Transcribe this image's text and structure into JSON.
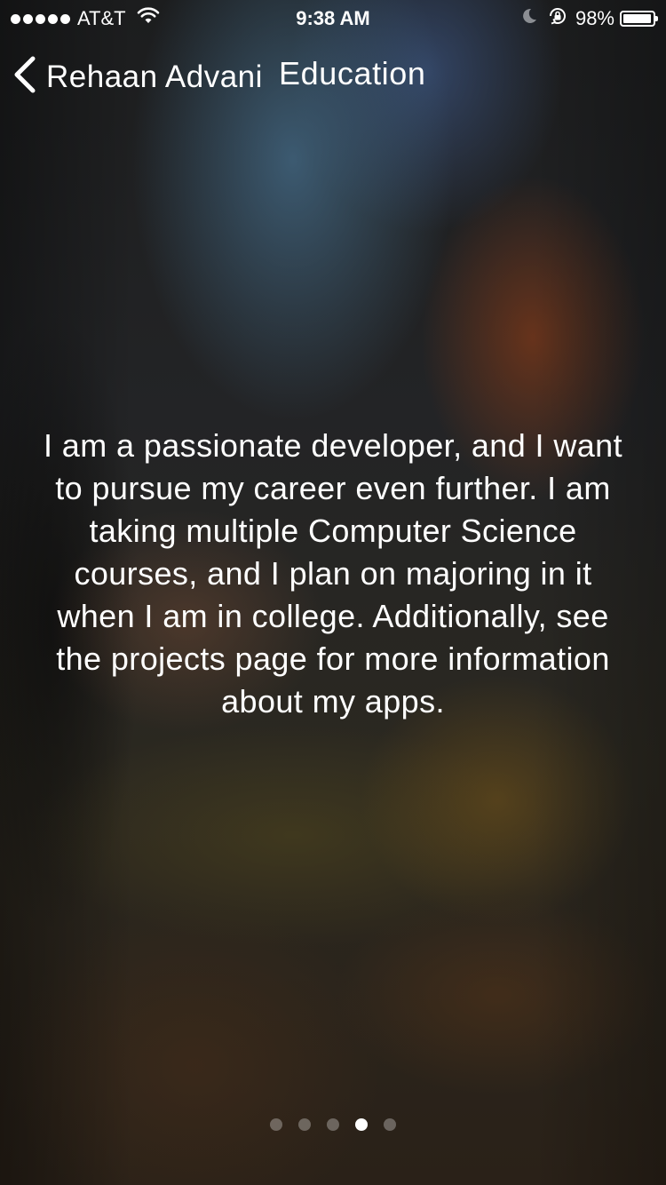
{
  "status_bar": {
    "carrier": "AT&T",
    "time": "9:38 AM",
    "battery_percent": "98%",
    "battery_level": 0.98,
    "signal_bars": 5,
    "icons": [
      "wifi-icon",
      "moon-icon",
      "rotation-lock-icon",
      "battery-icon"
    ]
  },
  "nav": {
    "back_label": "Rehaan Advani",
    "title": "Education",
    "back_icon": "chevron-left-icon"
  },
  "content": {
    "description": "I am a passionate developer, and I want to pursue my career even further. I am taking multiple Computer Science courses, and I plan on majoring in it when I am in college. Additionally, see the projects page for more information about my apps."
  },
  "page_control": {
    "total_pages": 5,
    "current_page": 4
  },
  "colors": {
    "text": "#ffffff",
    "page_dot_inactive": "rgba(255,255,255,0.3)",
    "page_dot_active": "#ffffff"
  }
}
